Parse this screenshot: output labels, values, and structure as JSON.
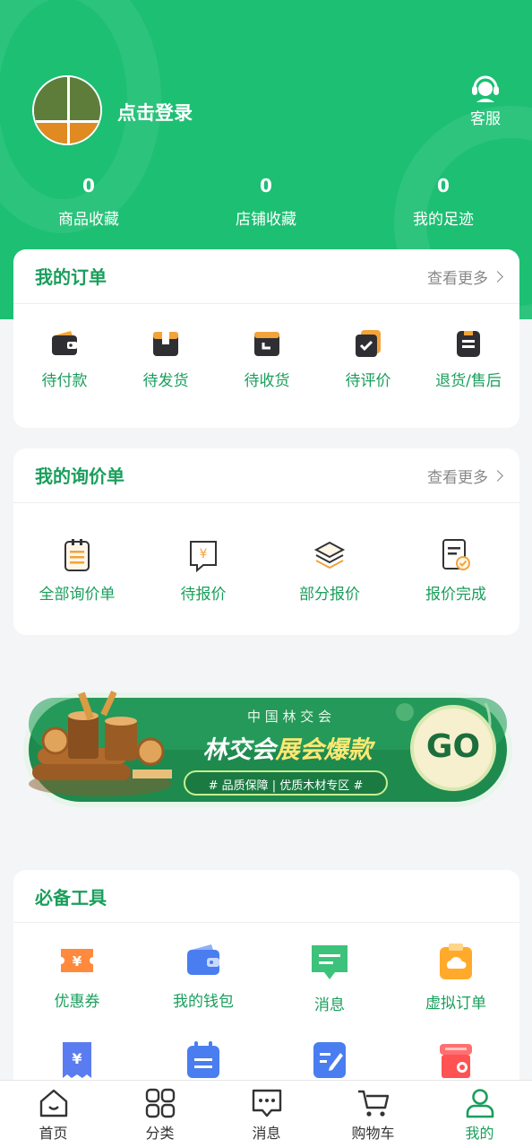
{
  "header": {
    "login_text": "点击登录",
    "service_label": "客服",
    "stats": [
      {
        "value": "0",
        "label": "商品收藏"
      },
      {
        "value": "0",
        "label": "店铺收藏"
      },
      {
        "value": "0",
        "label": "我的足迹"
      }
    ]
  },
  "orders": {
    "title": "我的订单",
    "more": "查看更多",
    "items": [
      {
        "label": "待付款",
        "icon": "wallet-icon"
      },
      {
        "label": "待发货",
        "icon": "package-icon"
      },
      {
        "label": "待收货",
        "icon": "receive-box-icon"
      },
      {
        "label": "待评价",
        "icon": "review-check-icon"
      },
      {
        "label": "退货/售后",
        "icon": "return-document-icon"
      }
    ]
  },
  "inquiry": {
    "title": "我的询价单",
    "more": "查看更多",
    "items": [
      {
        "label": "全部询价单",
        "icon": "clipboard-list-icon"
      },
      {
        "label": "待报价",
        "icon": "yuan-message-icon"
      },
      {
        "label": "部分报价",
        "icon": "layers-icon"
      },
      {
        "label": "报价完成",
        "icon": "document-check-icon"
      }
    ]
  },
  "banner": {
    "top": "中 国 林 交 会",
    "main_a": "林交会",
    "main_b": "展会爆款",
    "sub": "# 品质保障 | 优质木材专区 #",
    "button": "GO"
  },
  "tools": {
    "title": "必备工具",
    "items": [
      {
        "label": "优惠券",
        "icon": "coupon-icon"
      },
      {
        "label": "我的钱包",
        "icon": "wallet-icon"
      },
      {
        "label": "消息",
        "icon": "message-icon"
      },
      {
        "label": "虚拟订单",
        "icon": "cloud-order-icon"
      }
    ],
    "row2_icons": [
      "receipt-icon",
      "calendar-icon",
      "edit-note-icon",
      "gift-box-icon"
    ]
  },
  "nav": {
    "items": [
      {
        "label": "首页",
        "icon": "home-icon"
      },
      {
        "label": "分类",
        "icon": "grid-icon"
      },
      {
        "label": "消息",
        "icon": "chat-icon"
      },
      {
        "label": "购物车",
        "icon": "cart-icon"
      },
      {
        "label": "我的",
        "icon": "user-icon"
      }
    ],
    "active_index": 4
  },
  "colors": {
    "brand": "#1dbf73",
    "text_green": "#1a9e5c"
  }
}
